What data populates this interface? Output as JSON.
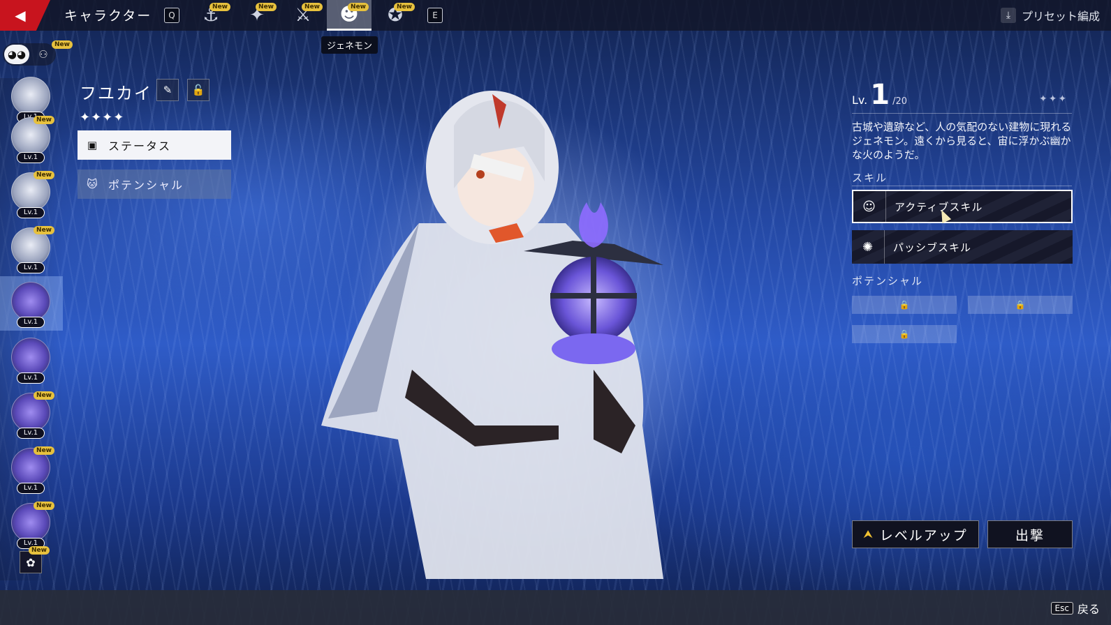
{
  "topbar": {
    "title": "キャラクター",
    "key_left": "Q",
    "key_right": "E",
    "tabs": [
      {
        "icon": "anchor-icon",
        "glyph": "⚓",
        "badge": "New"
      },
      {
        "icon": "emblem-icon",
        "glyph": "✦",
        "badge": "New"
      },
      {
        "icon": "crossed-swords-icon",
        "glyph": "⚔",
        "badge": "New"
      },
      {
        "icon": "genemon-icon",
        "glyph": "☻",
        "badge": "New"
      },
      {
        "icon": "star-disc-icon",
        "glyph": "✪",
        "badge": "New"
      }
    ],
    "active_tab_tooltip": "ジェネモン",
    "preset_label": "プリセット編成"
  },
  "toggle": {
    "badge": "New"
  },
  "character_list": [
    {
      "type": "ghost",
      "level": "Lv.1",
      "badge": ""
    },
    {
      "type": "ghost",
      "level": "Lv.1",
      "badge": "New"
    },
    {
      "type": "ghost",
      "level": "Lv.1",
      "badge": "New"
    },
    {
      "type": "ghost",
      "level": "Lv.1",
      "badge": "New"
    },
    {
      "type": "lantern",
      "level": "Lv.1",
      "badge": "",
      "selected": true
    },
    {
      "type": "lantern",
      "level": "Lv.1",
      "badge": ""
    },
    {
      "type": "lantern",
      "level": "Lv.1",
      "badge": "New"
    },
    {
      "type": "lantern",
      "level": "Lv.1",
      "badge": "New"
    },
    {
      "type": "lantern",
      "level": "Lv.1",
      "badge": "New"
    }
  ],
  "list_bottom_badge": "New",
  "character": {
    "name": "フユカイ",
    "stars": "✦✦✦✦",
    "rarity": 4
  },
  "menu": {
    "status": "ステータス",
    "potential": "ポテンシャル"
  },
  "panel": {
    "lv_prefix": "Lv.",
    "level": "1",
    "level_max": "/20",
    "rank_stars": "✦✦✦",
    "description": "古城や遺跡など、人の気配のない建物に現れるジェネモン。遠くから見ると、宙に浮かぶ幽かな火のようだ。",
    "skill_heading": "スキル",
    "active_skill": "アクティブスキル",
    "passive_skill": "パッシブスキル",
    "potential_heading": "ポテンシャル",
    "lock_glyph": "🔒"
  },
  "actions": {
    "level_up": "レベルアップ",
    "deploy": "出撃"
  },
  "footer": {
    "esc_key": "Esc",
    "back": "戻る"
  },
  "colors": {
    "accent_red": "#c8141e",
    "badge_yellow": "#e7c13e"
  }
}
